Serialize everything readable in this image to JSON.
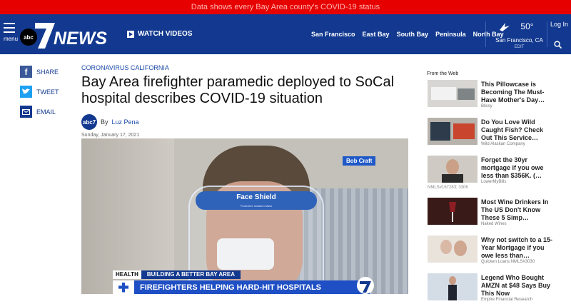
{
  "alert": {
    "text": "Data shows every Bay Area county's COVID-19 status"
  },
  "nav": {
    "menu_label": "menu",
    "logo": "abc7NEWS",
    "logo_abc": "abc",
    "logo_news": "NEWS",
    "watch_label": "WATCH VIDEOS",
    "regions": [
      "San Francisco",
      "East Bay",
      "South Bay",
      "Peninsula",
      "North Bay"
    ],
    "weather": {
      "temp": "50°",
      "city": "San Francisco, CA",
      "edit": "EDIT"
    },
    "login": "Log In"
  },
  "share": {
    "facebook": "SHARE",
    "twitter": "TWEET",
    "email": "EMAIL"
  },
  "article": {
    "section": "CORONAVIRUS CALIFORNIA",
    "headline": "Bay Area firefighter paramedic deployed to SoCal hospital describes COVID-19 situation",
    "by": "By",
    "author": "Luz Pena",
    "date": "Sunday, January 17, 2021",
    "video": {
      "name_tag": "Bob Craft",
      "shield_text": "Face Shield",
      "shield_sub": "Protective Isolation Mask",
      "lower_tag": "HEALTH",
      "lower_line1": "BUILDING A BETTER BAY AREA",
      "lower_line2": "FIREFIGHTERS HELPING HARD-HIT HOSPITALS"
    }
  },
  "sidebar": {
    "title": "From the Web",
    "ads": [
      {
        "title": "This Pillowcase is Becoming The Must-Have Mother's Day…",
        "source": "Blissy",
        "note": ""
      },
      {
        "title": "Do You Love Wild Caught Fish? Check Out This Service…",
        "source": "Wild Alaskan Company",
        "note": ""
      },
      {
        "title": "Forget the 30yr mortgage if you owe less than $356K. (…",
        "source": "LowerMyBills",
        "note": "NMLS#167283; 3306"
      },
      {
        "title": "Most Wine Drinkers In The US Don't Know These 5 Simp…",
        "source": "Naked Wines",
        "note": ""
      },
      {
        "title": "Why not switch to a 15-Year Mortgage if you owe less than…",
        "source": "Quicken Loans NMLS#3030",
        "note": ""
      },
      {
        "title": "Legend Who Bought AMZN at $48 Says Buy This Now",
        "source": "Empire Financial Research",
        "note": ""
      }
    ]
  },
  "colors": {
    "brand": "#12398f",
    "alert": "#e60000",
    "link": "#1b4aa8"
  }
}
